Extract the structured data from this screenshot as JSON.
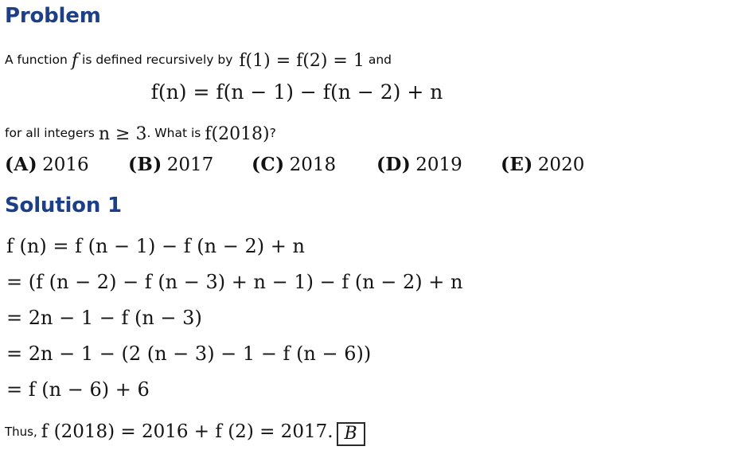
{
  "document": {
    "background_color": "#ffffff",
    "heading_color": "#1d3f85",
    "text_color": "#111111"
  },
  "sections": {
    "problem": {
      "heading": "Problem",
      "statement_prefix": "A function",
      "statement_var": "f",
      "statement_mid": "is defined recursively by",
      "base_case": "f(1) = f(2) = 1",
      "statement_suffix": "and",
      "display_equation": "f(n) = f(n − 1) − f(n − 2) + n",
      "condition_prefix": "for all integers",
      "condition_math": "n ≥ 3",
      "condition_mid": ". What is",
      "condition_query": "f(2018)",
      "condition_suffix": "?"
    },
    "choices": {
      "items": [
        {
          "label": "(A)",
          "value": "2016"
        },
        {
          "label": "(B)",
          "value": "2017"
        },
        {
          "label": "(C)",
          "value": "2018"
        },
        {
          "label": "(D)",
          "value": "2019"
        },
        {
          "label": "(E)",
          "value": "2020"
        }
      ]
    },
    "solution": {
      "heading": "Solution 1",
      "steps": [
        "f (n) = f (n − 1) − f (n − 2) + n",
        "= (f (n − 2) − f (n − 3) + n − 1) − f (n − 2) + n",
        "= 2n − 1 − f (n − 3)",
        "= 2n − 1 − (2 (n − 3) − 1 − f (n − 6))",
        "= f (n − 6) + 6"
      ],
      "conclusion_prefix": "Thus,",
      "conclusion_math": "f (2018) = 2016 + f (2) = 2017.",
      "boxed_answer": "B"
    }
  }
}
